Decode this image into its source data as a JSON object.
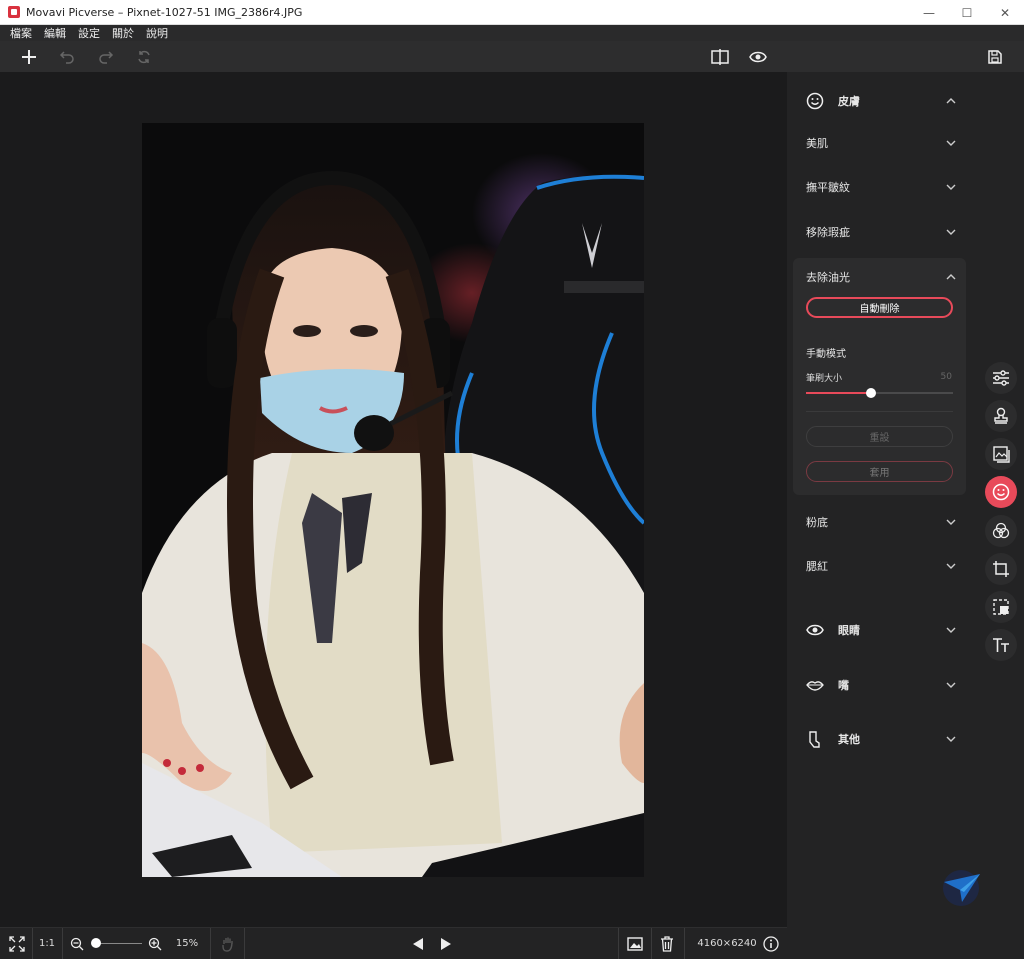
{
  "window": {
    "title": "Movavi Picverse – Pixnet-1027-51 IMG_2386r4.JPG",
    "controls": [
      "—",
      "☐",
      "✕"
    ]
  },
  "menu": {
    "items": [
      "檔案",
      "編輯",
      "設定",
      "關於",
      "說明"
    ]
  },
  "panel": {
    "skin_section": "皮膚",
    "items": {
      "smooth": "美肌",
      "wrinkles": "撫平皺紋",
      "blemish": "移除瑕疵",
      "shine": "去除油光",
      "foundation": "粉底",
      "blush": "腮紅"
    },
    "shine_controls": {
      "auto_button": "自動刪除",
      "manual_label": "手動模式",
      "brush_label": "筆刷大小",
      "brush_value": "50",
      "brush_fraction": 0.44,
      "reset_button": "重設",
      "apply_button": "套用"
    },
    "eyes_section": "眼睛",
    "mouth_section": "嘴",
    "other_section": "其他"
  },
  "statusbar": {
    "ratio": "1:1",
    "zoom": "15%",
    "zoom_fraction": 0.08,
    "dimensions": "4160×6240"
  },
  "colors": {
    "accent": "#e84a5a",
    "panel_bg": "#232324",
    "canvas_bg": "#1b1b1c"
  }
}
